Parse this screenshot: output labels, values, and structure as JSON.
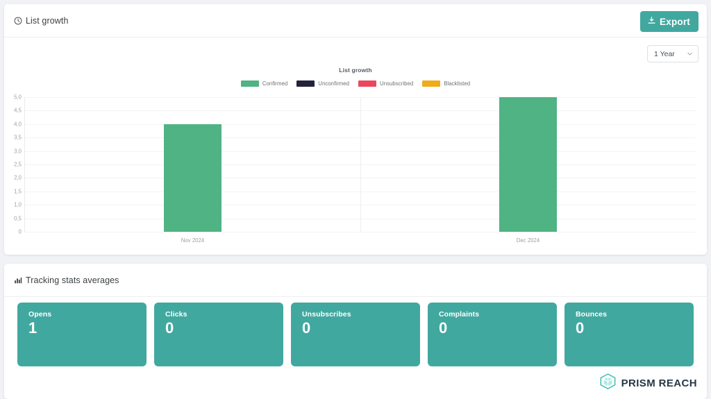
{
  "list_growth_panel": {
    "title": "List growth",
    "title_icon": "clock-icon",
    "export_label": "Export",
    "export_icon": "export-icon",
    "range_value": "1 Year",
    "range_icon": "chevron-down-icon",
    "accent_color": "#41a8a0"
  },
  "chart_data": {
    "type": "bar",
    "title": "List growth",
    "xlabel": "",
    "ylabel": "",
    "categories": [
      "Nov 2024",
      "Dec 2024"
    ],
    "yticks": [
      "5,0",
      "4,5",
      "4,0",
      "3,5",
      "3,0",
      "2,5",
      "2,0",
      "1,5",
      "1,0",
      "0,5",
      "0"
    ],
    "ylim": [
      0,
      5
    ],
    "grid": true,
    "legend_position": "top-center",
    "series": [
      {
        "name": "Confirmed",
        "color": "#4fb383",
        "values": [
          4,
          5
        ]
      },
      {
        "name": "Unconfirmed",
        "color": "#22223b",
        "values": [
          0,
          0
        ]
      },
      {
        "name": "Unsubscribed",
        "color": "#e9485f",
        "values": [
          0,
          0
        ]
      },
      {
        "name": "Blacklisted",
        "color": "#f0ab1b",
        "values": [
          0,
          0
        ]
      }
    ]
  },
  "tracking_panel": {
    "title": "Tracking stats averages",
    "title_icon": "bar-chart-icon",
    "cards": [
      {
        "label": "Opens",
        "value": "1"
      },
      {
        "label": "Clicks",
        "value": "0"
      },
      {
        "label": "Unsubscribes",
        "value": "0"
      },
      {
        "label": "Complaints",
        "value": "0"
      },
      {
        "label": "Bounces",
        "value": "0"
      }
    ]
  },
  "branding": {
    "logo_text": "PRISM REACH",
    "logo_icon": "prism-gem-icon",
    "logo_color": "#3bbfb2"
  }
}
